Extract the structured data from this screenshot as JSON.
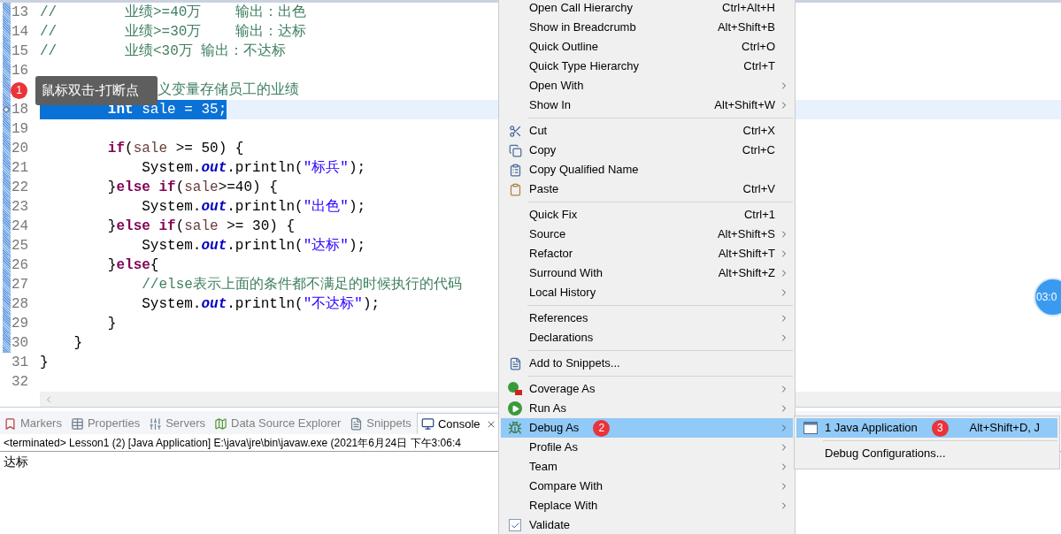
{
  "editor": {
    "lines": [
      {
        "number": "13",
        "changed": true,
        "current": false,
        "selected": false,
        "marked": false,
        "tokens": [
          {
            "kind": "comment",
            "text": "//        业绩>=40万    输出：出色"
          }
        ]
      },
      {
        "number": "14",
        "changed": true,
        "current": false,
        "selected": false,
        "marked": false,
        "tokens": [
          {
            "kind": "comment",
            "text": "//        业绩>=30万    输出：达标"
          }
        ]
      },
      {
        "number": "15",
        "changed": true,
        "current": false,
        "selected": false,
        "marked": false,
        "tokens": [
          {
            "kind": "comment",
            "text": "//        业绩<30万 输出：不达标"
          }
        ]
      },
      {
        "number": "16",
        "changed": true,
        "current": false,
        "selected": false,
        "marked": false
      },
      {
        "changed": true,
        "current": false,
        "selected": false,
        "marked": false,
        "tooltip": {
          "badge": "1",
          "text": "鼠标双击-打断点"
        },
        "tokens": [
          {
            "kind": "comment",
            "text": "义变量存储员工的业绩"
          }
        ]
      },
      {
        "number": "18",
        "changed": true,
        "current": true,
        "selected": true,
        "marked": true,
        "tokens": [
          {
            "kind": "keyword",
            "text": "        int"
          },
          {
            "kind": "plain",
            "text": " sale = 35;"
          }
        ]
      },
      {
        "number": "19",
        "changed": true,
        "current": false,
        "selected": false,
        "marked": false
      },
      {
        "number": "20",
        "changed": true,
        "current": false,
        "selected": false,
        "marked": false,
        "tokens": [
          {
            "kind": "keyword",
            "text": "        if"
          },
          {
            "kind": "plain",
            "text": "("
          },
          {
            "kind": "variable",
            "text": "sale"
          },
          {
            "kind": "plain",
            "text": " >= 50) {"
          }
        ]
      },
      {
        "number": "21",
        "changed": true,
        "current": false,
        "selected": false,
        "marked": false,
        "tokens": [
          {
            "kind": "plain",
            "text": "            System."
          },
          {
            "kind": "field",
            "text": "out"
          },
          {
            "kind": "plain",
            "text": ".println("
          },
          {
            "kind": "string",
            "text": "\"标兵\""
          },
          {
            "kind": "plain",
            "text": ");"
          }
        ]
      },
      {
        "number": "22",
        "changed": true,
        "current": false,
        "selected": false,
        "marked": false,
        "tokens": [
          {
            "kind": "plain",
            "text": "        }"
          },
          {
            "kind": "keyword",
            "text": "else if"
          },
          {
            "kind": "plain",
            "text": "("
          },
          {
            "kind": "variable",
            "text": "sale"
          },
          {
            "kind": "plain",
            "text": ">=40) {"
          }
        ]
      },
      {
        "number": "23",
        "changed": true,
        "current": false,
        "selected": false,
        "marked": false,
        "tokens": [
          {
            "kind": "plain",
            "text": "            System."
          },
          {
            "kind": "field",
            "text": "out"
          },
          {
            "kind": "plain",
            "text": ".println("
          },
          {
            "kind": "string",
            "text": "\"出色\""
          },
          {
            "kind": "plain",
            "text": ");"
          }
        ]
      },
      {
        "number": "24",
        "changed": true,
        "current": false,
        "selected": false,
        "marked": false,
        "tokens": [
          {
            "kind": "plain",
            "text": "        }"
          },
          {
            "kind": "keyword",
            "text": "else if"
          },
          {
            "kind": "plain",
            "text": "("
          },
          {
            "kind": "variable",
            "text": "sale"
          },
          {
            "kind": "plain",
            "text": " >= 30) {"
          }
        ]
      },
      {
        "number": "25",
        "changed": true,
        "current": false,
        "selected": false,
        "marked": false,
        "tokens": [
          {
            "kind": "plain",
            "text": "            System."
          },
          {
            "kind": "field",
            "text": "out"
          },
          {
            "kind": "plain",
            "text": ".println("
          },
          {
            "kind": "string",
            "text": "\"达标\""
          },
          {
            "kind": "plain",
            "text": ");"
          }
        ]
      },
      {
        "number": "26",
        "changed": true,
        "current": false,
        "selected": false,
        "marked": false,
        "tokens": [
          {
            "kind": "plain",
            "text": "        }"
          },
          {
            "kind": "keyword",
            "text": "else"
          },
          {
            "kind": "plain",
            "text": "{"
          }
        ]
      },
      {
        "number": "27",
        "changed": true,
        "current": false,
        "selected": false,
        "marked": false,
        "tokens": [
          {
            "kind": "comment",
            "text": "            //else表示上面的条件都不满足的时候执行的代码"
          }
        ]
      },
      {
        "number": "28",
        "changed": true,
        "current": false,
        "selected": false,
        "marked": false,
        "tokens": [
          {
            "kind": "plain",
            "text": "            System."
          },
          {
            "kind": "field",
            "text": "out"
          },
          {
            "kind": "plain",
            "text": ".println("
          },
          {
            "kind": "string",
            "text": "\"不达标\""
          },
          {
            "kind": "plain",
            "text": ");"
          }
        ]
      },
      {
        "number": "29",
        "changed": true,
        "current": false,
        "selected": false,
        "marked": false,
        "tokens": [
          {
            "kind": "plain",
            "text": "        }"
          }
        ]
      },
      {
        "number": "30",
        "changed": true,
        "current": false,
        "selected": false,
        "marked": false,
        "tokens": [
          {
            "kind": "plain",
            "text": "    }"
          }
        ]
      },
      {
        "number": "31",
        "changed": false,
        "current": false,
        "selected": false,
        "marked": false,
        "tokens": [
          {
            "kind": "plain",
            "text": "}"
          }
        ]
      },
      {
        "number": "32",
        "changed": false,
        "current": false,
        "selected": false,
        "marked": false
      }
    ]
  },
  "panel": {
    "tabs": [
      {
        "label": "Markers",
        "selected": false
      },
      {
        "label": "Properties",
        "selected": false
      },
      {
        "label": "Servers",
        "selected": false
      },
      {
        "label": "Data Source Explorer",
        "selected": false
      },
      {
        "label": "Snippets",
        "selected": false
      },
      {
        "label": "Console",
        "selected": true
      }
    ],
    "console": {
      "header": "<terminated> Lesson1 (2) [Java Application] E:\\java\\jre\\bin\\javaw.exe (2021年6月24日 下午3:06:4",
      "output": "达标"
    }
  },
  "timer": {
    "text": "03:0"
  },
  "context_menu": {
    "items": [
      {
        "kind": "plain",
        "label": "Open Call Hierarchy",
        "shortcut": "Ctrl+Alt+H",
        "submenu": false,
        "selected": false
      },
      {
        "kind": "plain",
        "label": "Show in Breadcrumb",
        "shortcut": "Alt+Shift+B",
        "submenu": false,
        "selected": false
      },
      {
        "kind": "plain",
        "label": "Quick Outline",
        "shortcut": "Ctrl+O",
        "submenu": false,
        "selected": false
      },
      {
        "kind": "plain",
        "label": "Quick Type Hierarchy",
        "shortcut": "Ctrl+T",
        "submenu": false,
        "selected": false
      },
      {
        "kind": "plain",
        "label": "Open With",
        "submenu": true,
        "selected": false
      },
      {
        "kind": "plain",
        "label": "Show In",
        "shortcut": "Alt+Shift+W",
        "submenu": true,
        "selected": false
      },
      {
        "kind": "separator"
      },
      {
        "kind": "scissors",
        "label": "Cut",
        "shortcut": "Ctrl+X",
        "submenu": false,
        "selected": false
      },
      {
        "kind": "copy",
        "label": "Copy",
        "shortcut": "Ctrl+C",
        "submenu": false,
        "selected": false
      },
      {
        "kind": "qualified",
        "label": "Copy Qualified Name",
        "submenu": false,
        "selected": false
      },
      {
        "kind": "paste",
        "label": "Paste",
        "shortcut": "Ctrl+V",
        "submenu": false,
        "selected": false
      },
      {
        "kind": "separator"
      },
      {
        "kind": "plain",
        "label": "Quick Fix",
        "shortcut": "Ctrl+1",
        "submenu": false,
        "selected": false
      },
      {
        "kind": "plain",
        "label": "Source",
        "shortcut": "Alt+Shift+S",
        "submenu": true,
        "selected": false
      },
      {
        "kind": "plain",
        "label": "Refactor",
        "shortcut": "Alt+Shift+T",
        "submenu": true,
        "selected": false
      },
      {
        "kind": "plain",
        "label": "Surround With",
        "shortcut": "Alt+Shift+Z",
        "submenu": true,
        "selected": false
      },
      {
        "kind": "plain",
        "label": "Local History",
        "submenu": true,
        "selected": false
      },
      {
        "kind": "separator"
      },
      {
        "kind": "plain",
        "label": "References",
        "submenu": true,
        "selected": false
      },
      {
        "kind": "plain",
        "label": "Declarations",
        "submenu": true,
        "selected": false
      },
      {
        "kind": "separator"
      },
      {
        "kind": "snippet",
        "label": "Add to Snippets...",
        "submenu": false,
        "selected": false
      },
      {
        "kind": "separator"
      },
      {
        "kind": "coverage",
        "label": "Coverage As",
        "submenu": true,
        "selected": false
      },
      {
        "kind": "run",
        "label": "Run As",
        "submenu": true,
        "selected": false
      },
      {
        "kind": "debug",
        "label": "Debug As",
        "submenu": true,
        "selected": true,
        "badge": "2"
      },
      {
        "kind": "plain",
        "label": "Profile As",
        "submenu": true,
        "selected": false
      },
      {
        "kind": "plain",
        "label": "Team",
        "submenu": true,
        "selected": false
      },
      {
        "kind": "plain",
        "label": "Compare With",
        "submenu": true,
        "selected": false
      },
      {
        "kind": "plain",
        "label": "Replace With",
        "submenu": true,
        "selected": false
      },
      {
        "kind": "checkbox",
        "label": "Validate",
        "submenu": false,
        "selected": false,
        "checked": true
      }
    ]
  },
  "submenu": {
    "items": [
      {
        "kind": "app",
        "label": "1 Java Application",
        "shortcut": "Alt+Shift+D, J",
        "selected": true,
        "badge": "3"
      },
      {
        "kind": "separator"
      },
      {
        "kind": "plain",
        "label": "Debug Configurations...",
        "selected": false
      }
    ]
  }
}
